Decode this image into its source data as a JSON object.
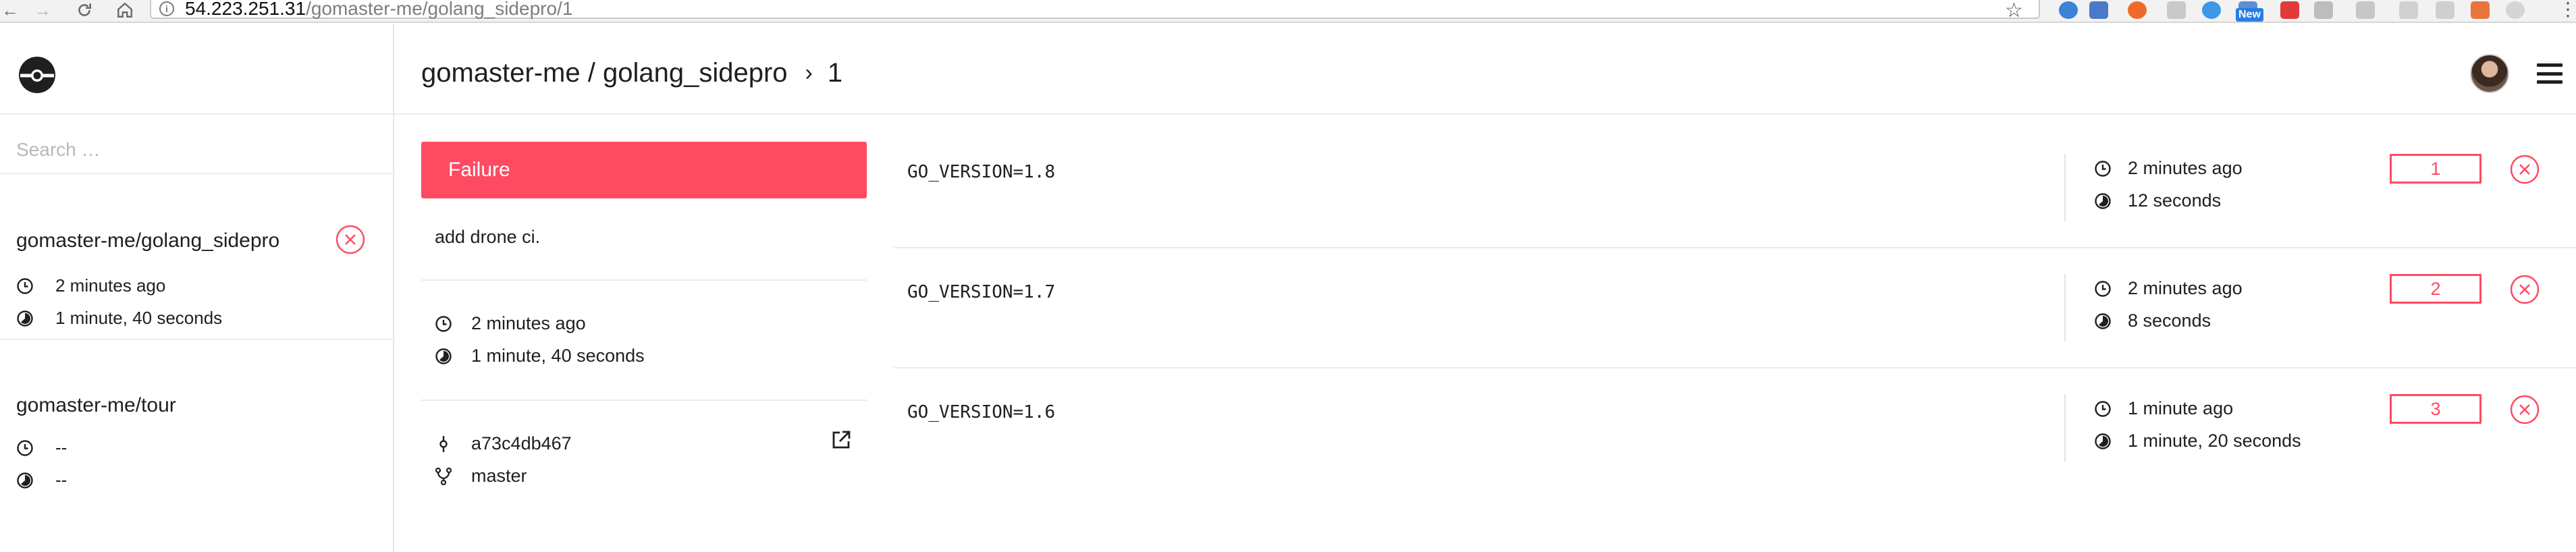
{
  "browser": {
    "url_host": "54.223.251.31",
    "url_path": "/gomaster-me/golang_sidepro/1",
    "ext_new_badge": "New"
  },
  "sidebar": {
    "search_placeholder": "Search …",
    "repos": [
      {
        "name": "gomaster-me/golang_sidepro",
        "time": "2 minutes ago",
        "duration": "1 minute, 40 seconds",
        "status": "failure"
      },
      {
        "name": "gomaster-me/tour",
        "time": "--",
        "duration": "--"
      }
    ]
  },
  "header": {
    "repo": "gomaster-me / golang_sidepro",
    "separator": "›",
    "build_number": "1"
  },
  "build": {
    "status": "Failure",
    "message": "add drone ci.",
    "time": "2 minutes ago",
    "duration": "1 minute, 40 seconds",
    "commit": "a73c4db467",
    "branch": "master"
  },
  "jobs": [
    {
      "env": "GO_VERSION=1.8",
      "time": "2 minutes ago",
      "duration": "12 seconds",
      "number": "1",
      "status": "failure"
    },
    {
      "env": "GO_VERSION=1.7",
      "time": "2 minutes ago",
      "duration": "8 seconds",
      "number": "2",
      "status": "failure"
    },
    {
      "env": "GO_VERSION=1.6",
      "time": "1 minute ago",
      "duration": "1 minute, 20 seconds",
      "number": "3",
      "status": "failure"
    }
  ],
  "colors": {
    "failure": "#ff4b61",
    "text": "#1f1f1f",
    "divider": "#ececec"
  }
}
